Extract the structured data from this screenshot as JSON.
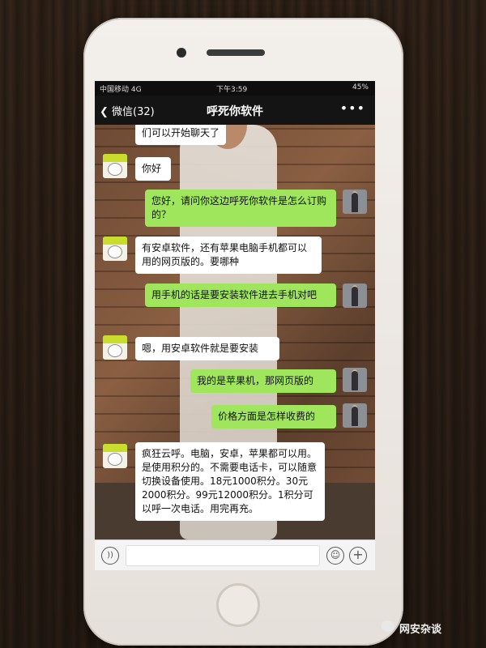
{
  "status_bar": {
    "carrier": "中国移动  4G",
    "time": "下午3:59",
    "battery": "45%"
  },
  "nav": {
    "back_label": "微信(32)",
    "title": "呼死你软件",
    "more": "•••"
  },
  "messages": [
    {
      "side": "left",
      "text": "们可以开始聊天了"
    },
    {
      "side": "left",
      "text": "你好"
    },
    {
      "side": "right",
      "text": "您好，请问你这边呼死你软件是怎么订购的？"
    },
    {
      "side": "left",
      "text": "有安卓软件，还有苹果电脑手机都可以用的网页版的。要哪种"
    },
    {
      "side": "right",
      "text": "用手机的话是要安装软件进去手机对吧"
    },
    {
      "side": "left",
      "text": "嗯，用安卓软件就是要安装"
    },
    {
      "side": "right",
      "text": "我的是苹果机，那网页版的"
    },
    {
      "side": "right",
      "text": "价格方面是怎样收费的"
    },
    {
      "side": "left",
      "text": "疯狂云呼。电脑，安卓，苹果都可以用。是使用积分的。不需要电话卡，可以随意切换设备使用。18元1000积分。30元2000积分。99元12000积分。1积分可以呼一次电话。用完再充。"
    }
  ],
  "input": {
    "voice_icon": "voice-icon",
    "emoji_icon": "emoji-icon",
    "plus_icon": "plus-icon"
  },
  "watermark": {
    "text": "网安杂谈"
  }
}
